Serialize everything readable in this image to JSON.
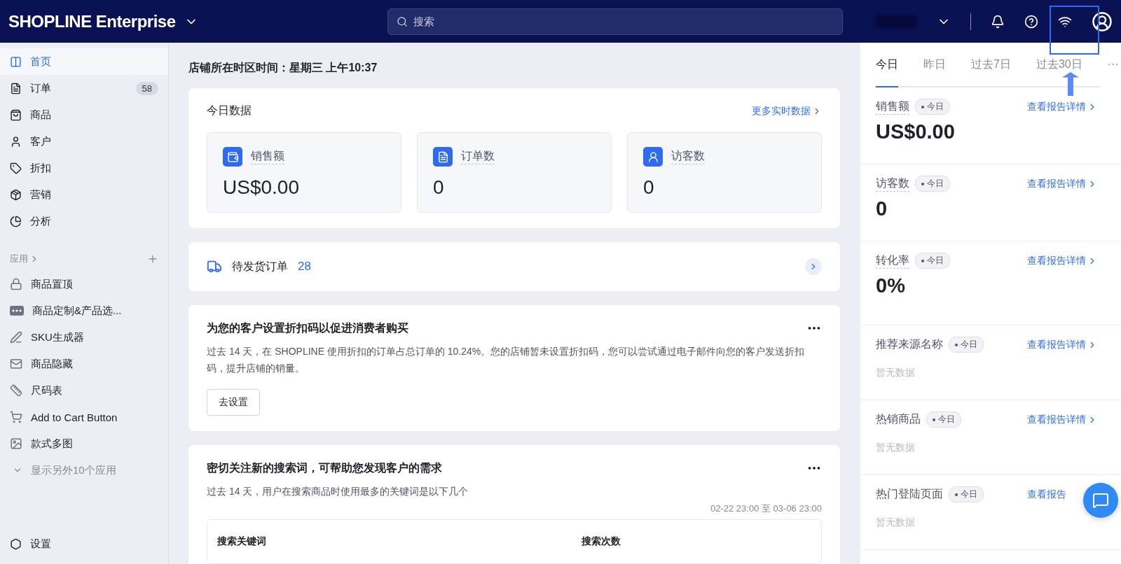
{
  "topbar": {
    "logo": "SHOPLINE Enterprise",
    "search": {
      "placeholder": "搜索"
    }
  },
  "sidebar": {
    "items": [
      {
        "label": "首页",
        "selected": true
      },
      {
        "label": "订单",
        "selected": false,
        "badge": "58"
      },
      {
        "label": "商品",
        "selected": false
      },
      {
        "label": "客户",
        "selected": false
      },
      {
        "label": "折扣",
        "selected": false
      },
      {
        "label": "营销",
        "selected": false
      },
      {
        "label": "分析",
        "selected": false
      }
    ],
    "apps_header": "应用",
    "apps": [
      {
        "label": "商品置顶"
      },
      {
        "label": "商品定制&产品选..."
      },
      {
        "label": "SKU生成器"
      },
      {
        "label": "商品隐藏"
      },
      {
        "label": "尺码表"
      },
      {
        "label": "Add to Cart Button"
      },
      {
        "label": "款式多图"
      }
    ],
    "show_more": "显示另外10个应用",
    "settings": "设置"
  },
  "main": {
    "store_time": "店铺所在时区时间：星期三 上午10:37",
    "today": {
      "title": "今日数据",
      "link": "更多实时数据",
      "stats": [
        {
          "label": "销售额",
          "value": "US$0.00"
        },
        {
          "label": "订单数",
          "value": "0"
        },
        {
          "label": "访客数",
          "value": "0"
        }
      ]
    },
    "pending": {
      "label": "待发货订单",
      "count": "28"
    },
    "discount": {
      "title": "为您的客户设置折扣码以促进消费者购买",
      "body": "过去 14 天，在 SHOPLINE 使用折扣的订单占总订单的 10.24%。您的店铺暂未设置折扣码，您可以尝试通过电子邮件向您的客户发送折扣码，提升店铺的销量。",
      "button": "去设置"
    },
    "search_terms": {
      "title": "密切关注新的搜索词，可帮助您发现客户的需求",
      "body": "过去 14 天，用户在搜索商品时使用最多的关键词是以下几个",
      "range": "02-22 23:00 至 03-06 23:00",
      "columns": [
        "搜索关键词",
        "搜索次数"
      ]
    }
  },
  "right_panel": {
    "tabs": [
      {
        "label": "今日",
        "selected": true
      },
      {
        "label": "昨日",
        "selected": false
      },
      {
        "label": "过去7日",
        "selected": false
      },
      {
        "label": "过去30日",
        "selected": false
      }
    ],
    "more": "···",
    "metrics": [
      {
        "kind": "value",
        "label": "销售额",
        "period": "今日",
        "link": "查看报告详情",
        "value": "US$0.00"
      },
      {
        "kind": "value",
        "label": "访客数",
        "period": "今日",
        "link": "查看报告详情",
        "value": "0"
      },
      {
        "kind": "value",
        "label": "转化率",
        "period": "今日",
        "link": "查看报告详情",
        "value": "0%"
      },
      {
        "kind": "empty",
        "label": "推荐来源名称",
        "period": "今日",
        "link": "查看报告详情",
        "value": "暂无数据"
      },
      {
        "kind": "empty",
        "label": "热销商品",
        "period": "今日",
        "link": "查看报告详情",
        "value": "暂无数据"
      },
      {
        "kind": "empty",
        "label": "热门登陆页面",
        "period": "今日",
        "link": "查看报告",
        "value": "暂无数据"
      }
    ]
  }
}
